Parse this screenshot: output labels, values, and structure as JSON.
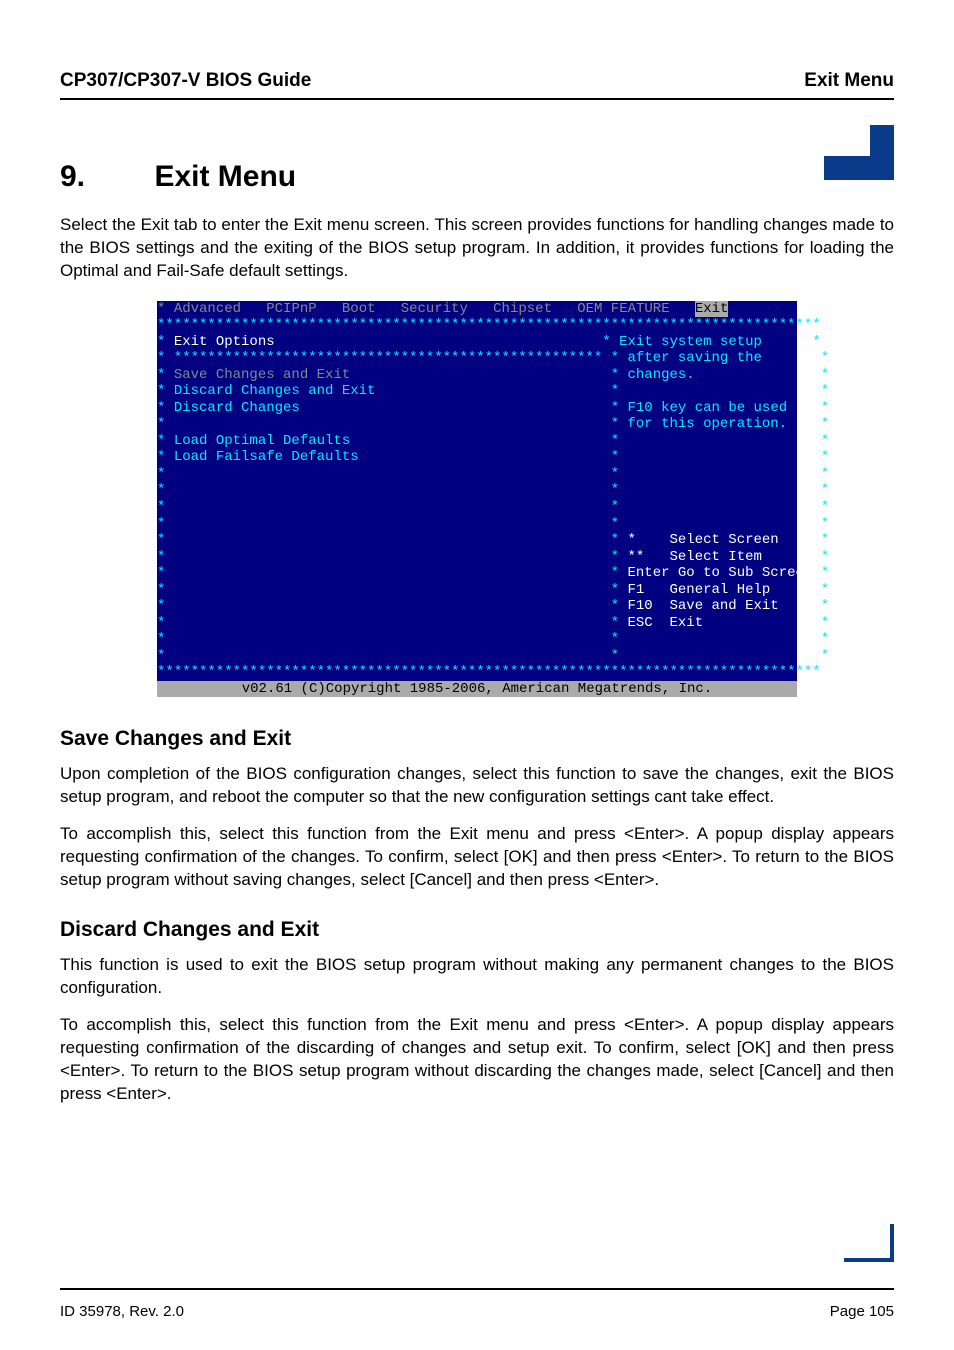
{
  "header": {
    "left": "CP307/CP307-V BIOS Guide",
    "right": "Exit Menu"
  },
  "chapter": {
    "num": "9.",
    "title": "Exit Menu"
  },
  "intro": "Select the Exit tab to enter the Exit menu screen. This screen provides functions for handling changes made to the BIOS settings and the exiting of the BIOS setup program. In addition, it provides functions for loading the Optimal and Fail-Safe default settings.",
  "bios": {
    "tabs": [
      "Advanced",
      "PCIPnP",
      "Boot",
      "Security",
      "Chipset",
      "OEM FEATURE",
      "Exit"
    ],
    "stars_full": "*******************************************************************************",
    "stars_half": " ***************************************************",
    "exit_options": "Exit Options",
    "items": [
      "Save Changes and Exit",
      "Discard Changes and Exit",
      "Discard Changes",
      "",
      "Load Optimal Defaults",
      "Load Failsafe Defaults"
    ],
    "help": [
      "Exit system setup",
      "after saving the",
      "changes.",
      "",
      "F10 key can be used",
      "for this operation."
    ],
    "nav": [
      "*    Select Screen",
      "**   Select Item",
      "Enter Go to Sub Screen",
      "F1   General Help",
      "F10  Save and Exit",
      "ESC  Exit"
    ],
    "footer": "v02.61 (C)Copyright 1985-2006, American Megatrends, Inc."
  },
  "sections": {
    "save": {
      "title": "Save Changes and Exit",
      "p1": "Upon completion of the BIOS configuration changes, select this function to save the changes, exit the BIOS setup program, and reboot the computer so that the new configuration settings cant take effect.",
      "p2": "To accomplish this, select this function from the Exit menu and press <Enter>. A popup display appears requesting confirmation of the changes. To confirm, select [OK] and then press <Enter>. To return to the BIOS setup program without saving changes, select [Cancel] and then press <Enter>."
    },
    "discard": {
      "title": "Discard Changes and Exit",
      "p1": "This function is used to exit the BIOS setup program without making any permanent changes to the BIOS configuration.",
      "p2": "To accomplish this, select this function from the Exit menu and press <Enter>. A popup display appears requesting confirmation of the discarding of changes and setup exit. To confirm, select [OK] and then press <Enter>. To return to the BIOS setup program without discarding the changes made, select [Cancel] and then press <Enter>."
    }
  },
  "footer": {
    "left": "ID 35978, Rev. 2.0",
    "right": "Page 105"
  }
}
